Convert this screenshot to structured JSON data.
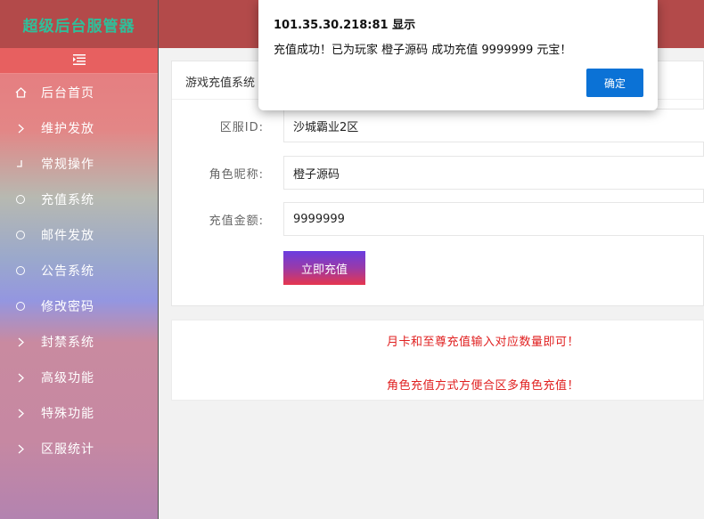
{
  "brand": {
    "title": "超级后台服管器"
  },
  "sidebar": {
    "collapse_icon": "menu-collapse-icon",
    "items": [
      {
        "label": "后台首页",
        "icon": "home-icon"
      },
      {
        "label": "维护发放",
        "icon": "chevron-right-icon"
      },
      {
        "label": "常规操作",
        "icon": "corner-icon"
      },
      {
        "label": "充值系统",
        "icon": "circle-icon"
      },
      {
        "label": "邮件发放",
        "icon": "circle-icon"
      },
      {
        "label": "公告系统",
        "icon": "circle-icon"
      },
      {
        "label": "修改密码",
        "icon": "circle-icon"
      },
      {
        "label": "封禁系统",
        "icon": "chevron-right-icon"
      },
      {
        "label": "高级功能",
        "icon": "chevron-right-icon"
      },
      {
        "label": "特殊功能",
        "icon": "chevron-right-icon"
      },
      {
        "label": "区服统计",
        "icon": "chevron-right-icon"
      }
    ]
  },
  "panel": {
    "title": "游戏充值系统",
    "fields": [
      {
        "label": "区服ID:",
        "value": "沙城霸业2区"
      },
      {
        "label": "角色昵称:",
        "value": "橙子源码"
      },
      {
        "label": "充值金额:",
        "value": "9999999"
      }
    ],
    "submit_label": "立即充值"
  },
  "notices": [
    "月卡和至尊充值输入对应数量即可！",
    "角色充值方式方便合区多角色充值！"
  ],
  "dialog": {
    "title": "101.35.30.218:81 显示",
    "message": "充值成功！已为玩家 橙子源码 成功充值 9999999 元宝！",
    "ok_label": "确定"
  },
  "colors": {
    "header": "#b34a4a",
    "brand_text": "#2fbf9a",
    "dialog_button": "#0b72d6",
    "notice_text": "#e02020"
  }
}
